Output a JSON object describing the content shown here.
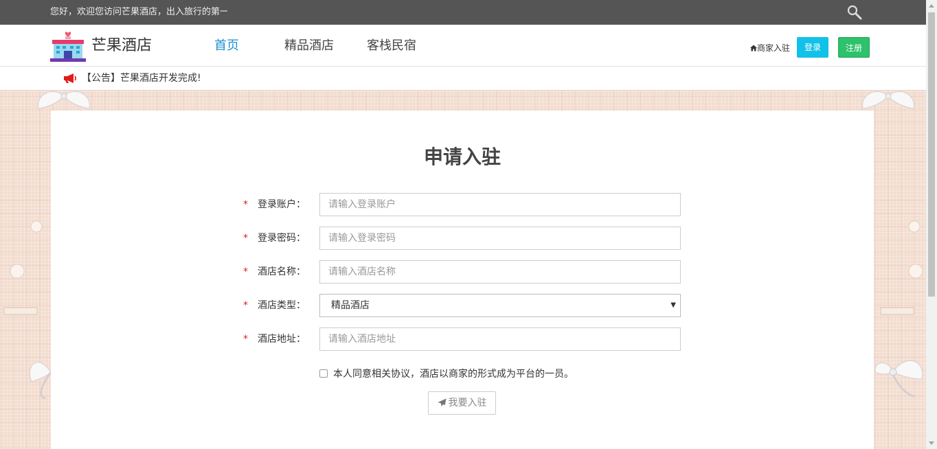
{
  "topbar": {
    "welcome": "您好，欢迎您访问芒果酒店，出入旅行的第一选择！"
  },
  "header": {
    "brand": "芒果酒店",
    "nav": [
      "首页",
      "精品酒店",
      "客栈民宿"
    ],
    "merchant": "商家入驻",
    "login": "登录",
    "register": "注册"
  },
  "notice": {
    "text": "【公告】芒果酒店开发完成!"
  },
  "form": {
    "title": "申请入驻",
    "required_mark": "*",
    "fields": [
      {
        "label": "登录账户：",
        "placeholder": "请输入登录账户"
      },
      {
        "label": "登录密码：",
        "placeholder": "请输入登录密码"
      },
      {
        "label": "酒店名称：",
        "placeholder": "请输入酒店名称"
      },
      {
        "label": "酒店类型：",
        "value": "精品酒店"
      },
      {
        "label": "酒店地址：",
        "placeholder": "请输入酒店地址"
      }
    ],
    "agreement": "本人同意相关协议，酒店以商家的形式成为平台的一员。",
    "submit": "我要入驻"
  },
  "colors": {
    "accent": "#1f8fd0",
    "login_btn": "#12c1e8",
    "register_btn": "#2dc26b",
    "required": "#e02020"
  }
}
